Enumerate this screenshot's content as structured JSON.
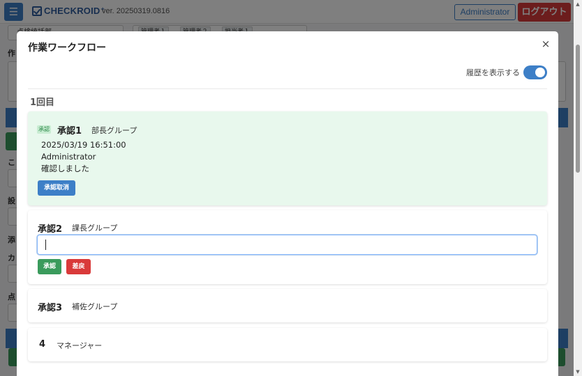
{
  "app": {
    "logo_text": "CHECKROID",
    "logo_suffix": "+",
    "version": "ver. 20250319.0816",
    "user_button": "Administrator",
    "logout_button": "ログアウト",
    "menu_icon": "hamburger-icon",
    "background": {
      "field_text": "点検統括部",
      "tags": [
        "管理者１",
        "管理者２",
        "担当者１"
      ],
      "labels": [
        "作",
        "こ",
        "設",
        "添",
        "カ",
        "点"
      ]
    }
  },
  "modal": {
    "title": "作業ワークフロー",
    "close_icon": "×",
    "history_toggle": {
      "label": "履歴を表示する",
      "on": true
    },
    "round_title": "1回目",
    "steps": [
      {
        "status_badge": "承認",
        "title": "承認1",
        "group": "部長グループ",
        "timestamp": "2025/03/19 16:51:00",
        "user": "Administrator",
        "comment": "確認しました",
        "button": "承認取消"
      },
      {
        "title": "承認2",
        "group": "課長グループ",
        "comment_value": "",
        "approve_button": "承認",
        "reject_button": "差戻"
      },
      {
        "title": "承認3",
        "group": "補佐グループ"
      },
      {
        "title": "4",
        "group": "マネージャー"
      }
    ]
  },
  "colors": {
    "primary": "#3d7fc7",
    "success": "#3a9b5c",
    "danger": "#d93a3a",
    "approved_bg": "#e8f8ed"
  }
}
